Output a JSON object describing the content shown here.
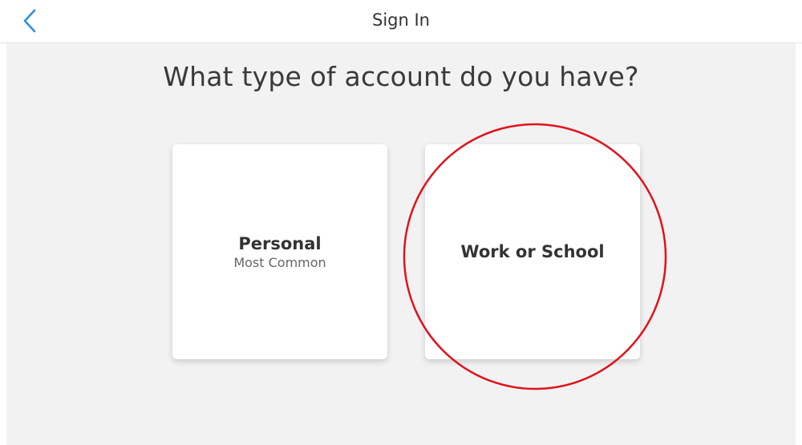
{
  "header": {
    "title": "Sign In",
    "back_icon": "chevron-left-icon",
    "accent_color": "#2f8fe0"
  },
  "main": {
    "heading": "What type of account do you have?",
    "options": [
      {
        "label": "Personal",
        "sublabel": "Most Common"
      },
      {
        "label": "Work or School",
        "sublabel": ""
      }
    ]
  },
  "annotation": {
    "shape": "circle",
    "color": "#e0121b",
    "target": "Work or School"
  }
}
